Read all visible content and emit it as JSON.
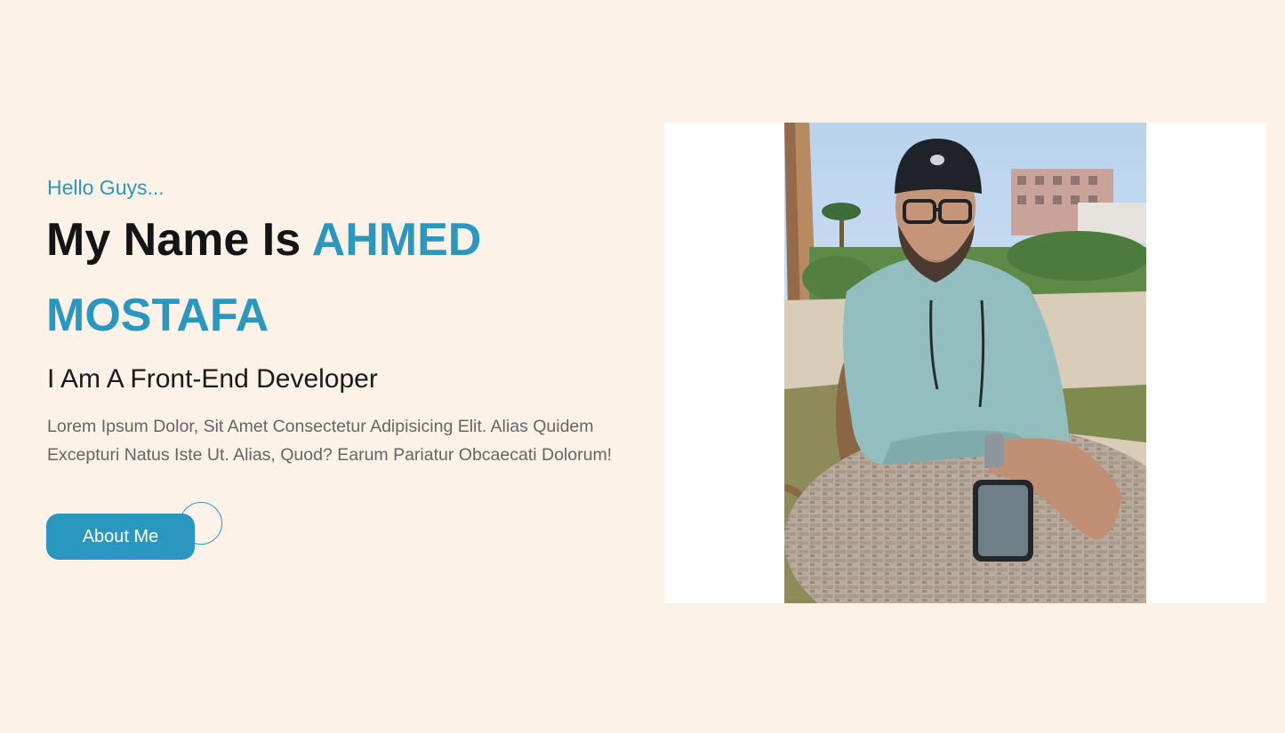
{
  "hero": {
    "greeting": "Hello Guys...",
    "headline_prefix": "My Name Is ",
    "name": "AHMED MOSTAFA",
    "role": "I Am A Front-End Developer",
    "description": "Lorem Ipsum Dolor, Sit Amet Consectetur Adipisicing Elit. Alias Quidem Excepturi Natus Iste Ut. Alias, Quod? Earum Pariatur Obcaecati Dolorum!",
    "cta_label": "About Me"
  },
  "colors": {
    "background": "#fcf2e8",
    "accent": "#2a97c0",
    "heading": "#141414",
    "body_text": "#656565"
  }
}
